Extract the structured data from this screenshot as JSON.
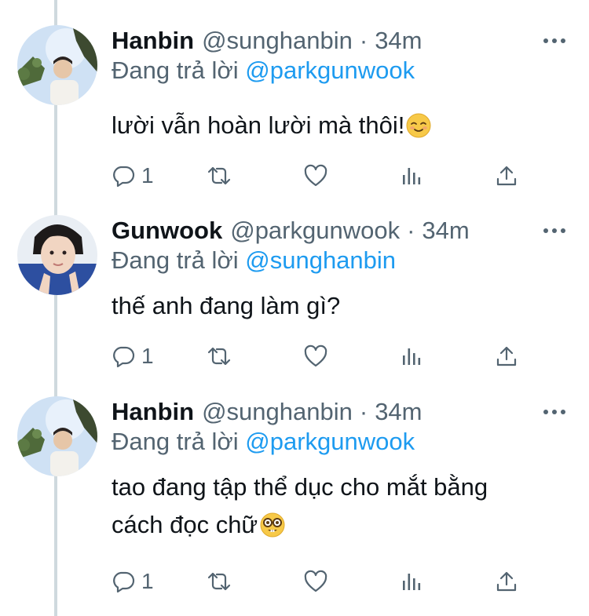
{
  "tweets": [
    {
      "name": "Hanbin",
      "handle": "@sunghanbin",
      "separator": "·",
      "time": "34m",
      "reply_prefix": "Đang trả lời",
      "reply_to": "@parkgunwook",
      "text": "lười vẫn hoàn lười mà thôi!",
      "text_line2": "",
      "emoji": "relieved-face",
      "reply_count": "1"
    },
    {
      "name": "Gunwook",
      "handle": "@parkgunwook",
      "separator": "·",
      "time": "34m",
      "reply_prefix": "Đang trả lời",
      "reply_to": "@sunghanbin",
      "text": "thế anh đang làm gì?",
      "text_line2": "",
      "emoji": "",
      "reply_count": "1"
    },
    {
      "name": "Hanbin",
      "handle": "@sunghanbin",
      "separator": "·",
      "time": "34m",
      "reply_prefix": "Đang trả lời",
      "reply_to": "@parkgunwook",
      "text": "tao đang tập thể dục cho mắt bằng",
      "text_line2": "cách đọc chữ",
      "emoji": "nerd-face",
      "reply_count": "1"
    }
  ],
  "colors": {
    "text": "#0f1419",
    "secondary": "#536471",
    "link": "#1d9bf0",
    "thread_line": "#cfd9de"
  },
  "icons": [
    "reply-icon",
    "retweet-icon",
    "like-icon",
    "analytics-icon",
    "share-icon",
    "more-icon"
  ]
}
